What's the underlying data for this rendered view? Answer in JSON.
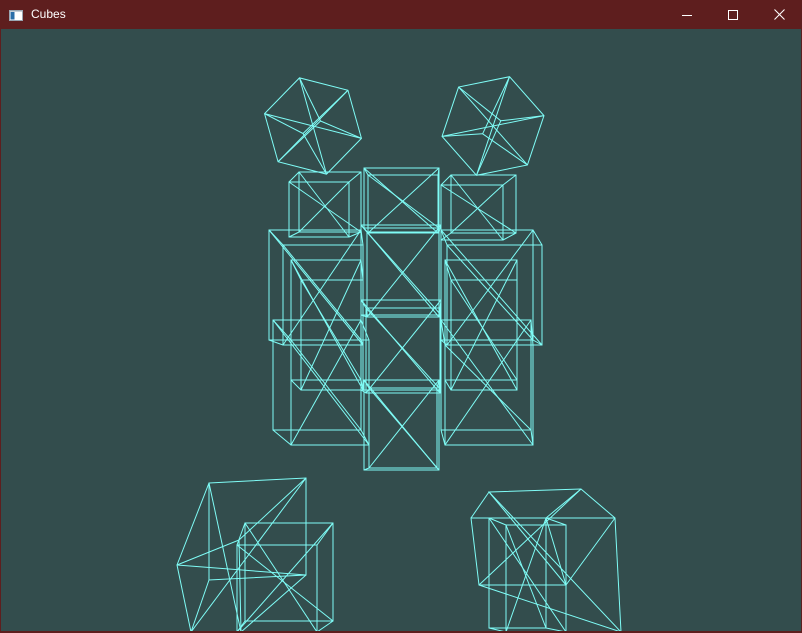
{
  "window": {
    "title": "Cubes",
    "icons": {
      "app": "window-app-icon",
      "minimize": "minimize-icon",
      "maximize": "maximize-icon",
      "close": "close-icon"
    }
  },
  "colors": {
    "titlebar": "#5e1e1e",
    "background": "#334d4d",
    "wireframe": "#7ffcf6"
  }
}
